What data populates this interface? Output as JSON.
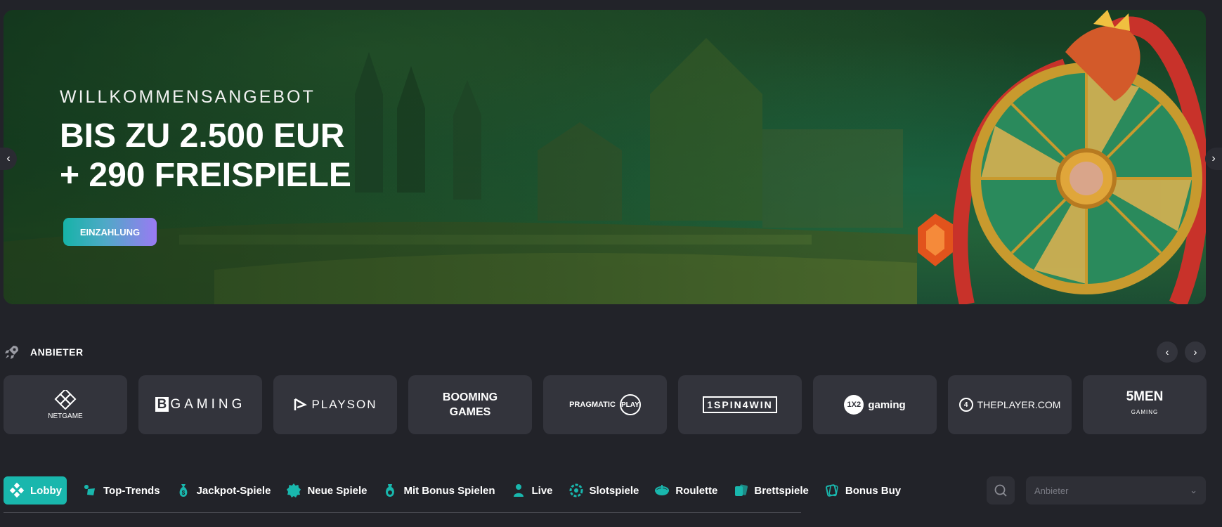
{
  "hero": {
    "kicker": "WILLKOMMENSANGEBOT",
    "title_line1": "BIS ZU 2.500 EUR",
    "title_line2": "+ 290 FREISPIELE",
    "cta_label": "EINZAHLUNG",
    "prev_icon": "chevron-left-icon",
    "next_icon": "chevron-right-icon",
    "prev_glyph": "‹",
    "next_glyph": "›"
  },
  "providers": {
    "title": "ANBIETER",
    "prev_glyph": "‹",
    "next_glyph": "›",
    "items": [
      {
        "id": "netgame",
        "text": "NETGAME"
      },
      {
        "id": "bgaming",
        "text_b": "B",
        "text": "GAMING"
      },
      {
        "id": "playson",
        "text": "PLAYSON"
      },
      {
        "id": "booming",
        "text1": "BOOMING",
        "text2": "GAMES"
      },
      {
        "id": "pragmatic",
        "text": "PRAGMATIC",
        "text2": "PLAY"
      },
      {
        "id": "spin",
        "text": "1SPIN4WIN"
      },
      {
        "id": "1x2",
        "badge": "1X2",
        "text": "gaming"
      },
      {
        "id": "4theplayer",
        "badge": "4",
        "text": "THEPLAYER.COM"
      },
      {
        "id": "5men",
        "text": "5MEN",
        "text2": "GAMING"
      }
    ]
  },
  "tabs": [
    {
      "label": "Lobby",
      "icon": "lobby-icon",
      "active": true
    },
    {
      "label": "Top-Trends",
      "icon": "trends-icon"
    },
    {
      "label": "Jackpot-Spiele",
      "icon": "money-bag-icon"
    },
    {
      "label": "Neue Spiele",
      "icon": "new-badge-icon"
    },
    {
      "label": "Mit Bonus Spielen",
      "icon": "bonus-icon"
    },
    {
      "label": "Live",
      "icon": "dealer-icon"
    },
    {
      "label": "Slotspiele",
      "icon": "slot-icon"
    },
    {
      "label": "Roulette",
      "icon": "roulette-icon"
    },
    {
      "label": "Brettspiele",
      "icon": "cards-icon"
    },
    {
      "label": "Bonus Buy",
      "icon": "bonus-buy-icon"
    }
  ],
  "search": {
    "icon": "search-icon"
  },
  "provider_select": {
    "placeholder": "Anbieter",
    "icon": "chevron-down-icon",
    "glyph": "⌄"
  },
  "colors": {
    "accent": "#19b7ad",
    "background": "#222329",
    "card": "#33343c"
  }
}
